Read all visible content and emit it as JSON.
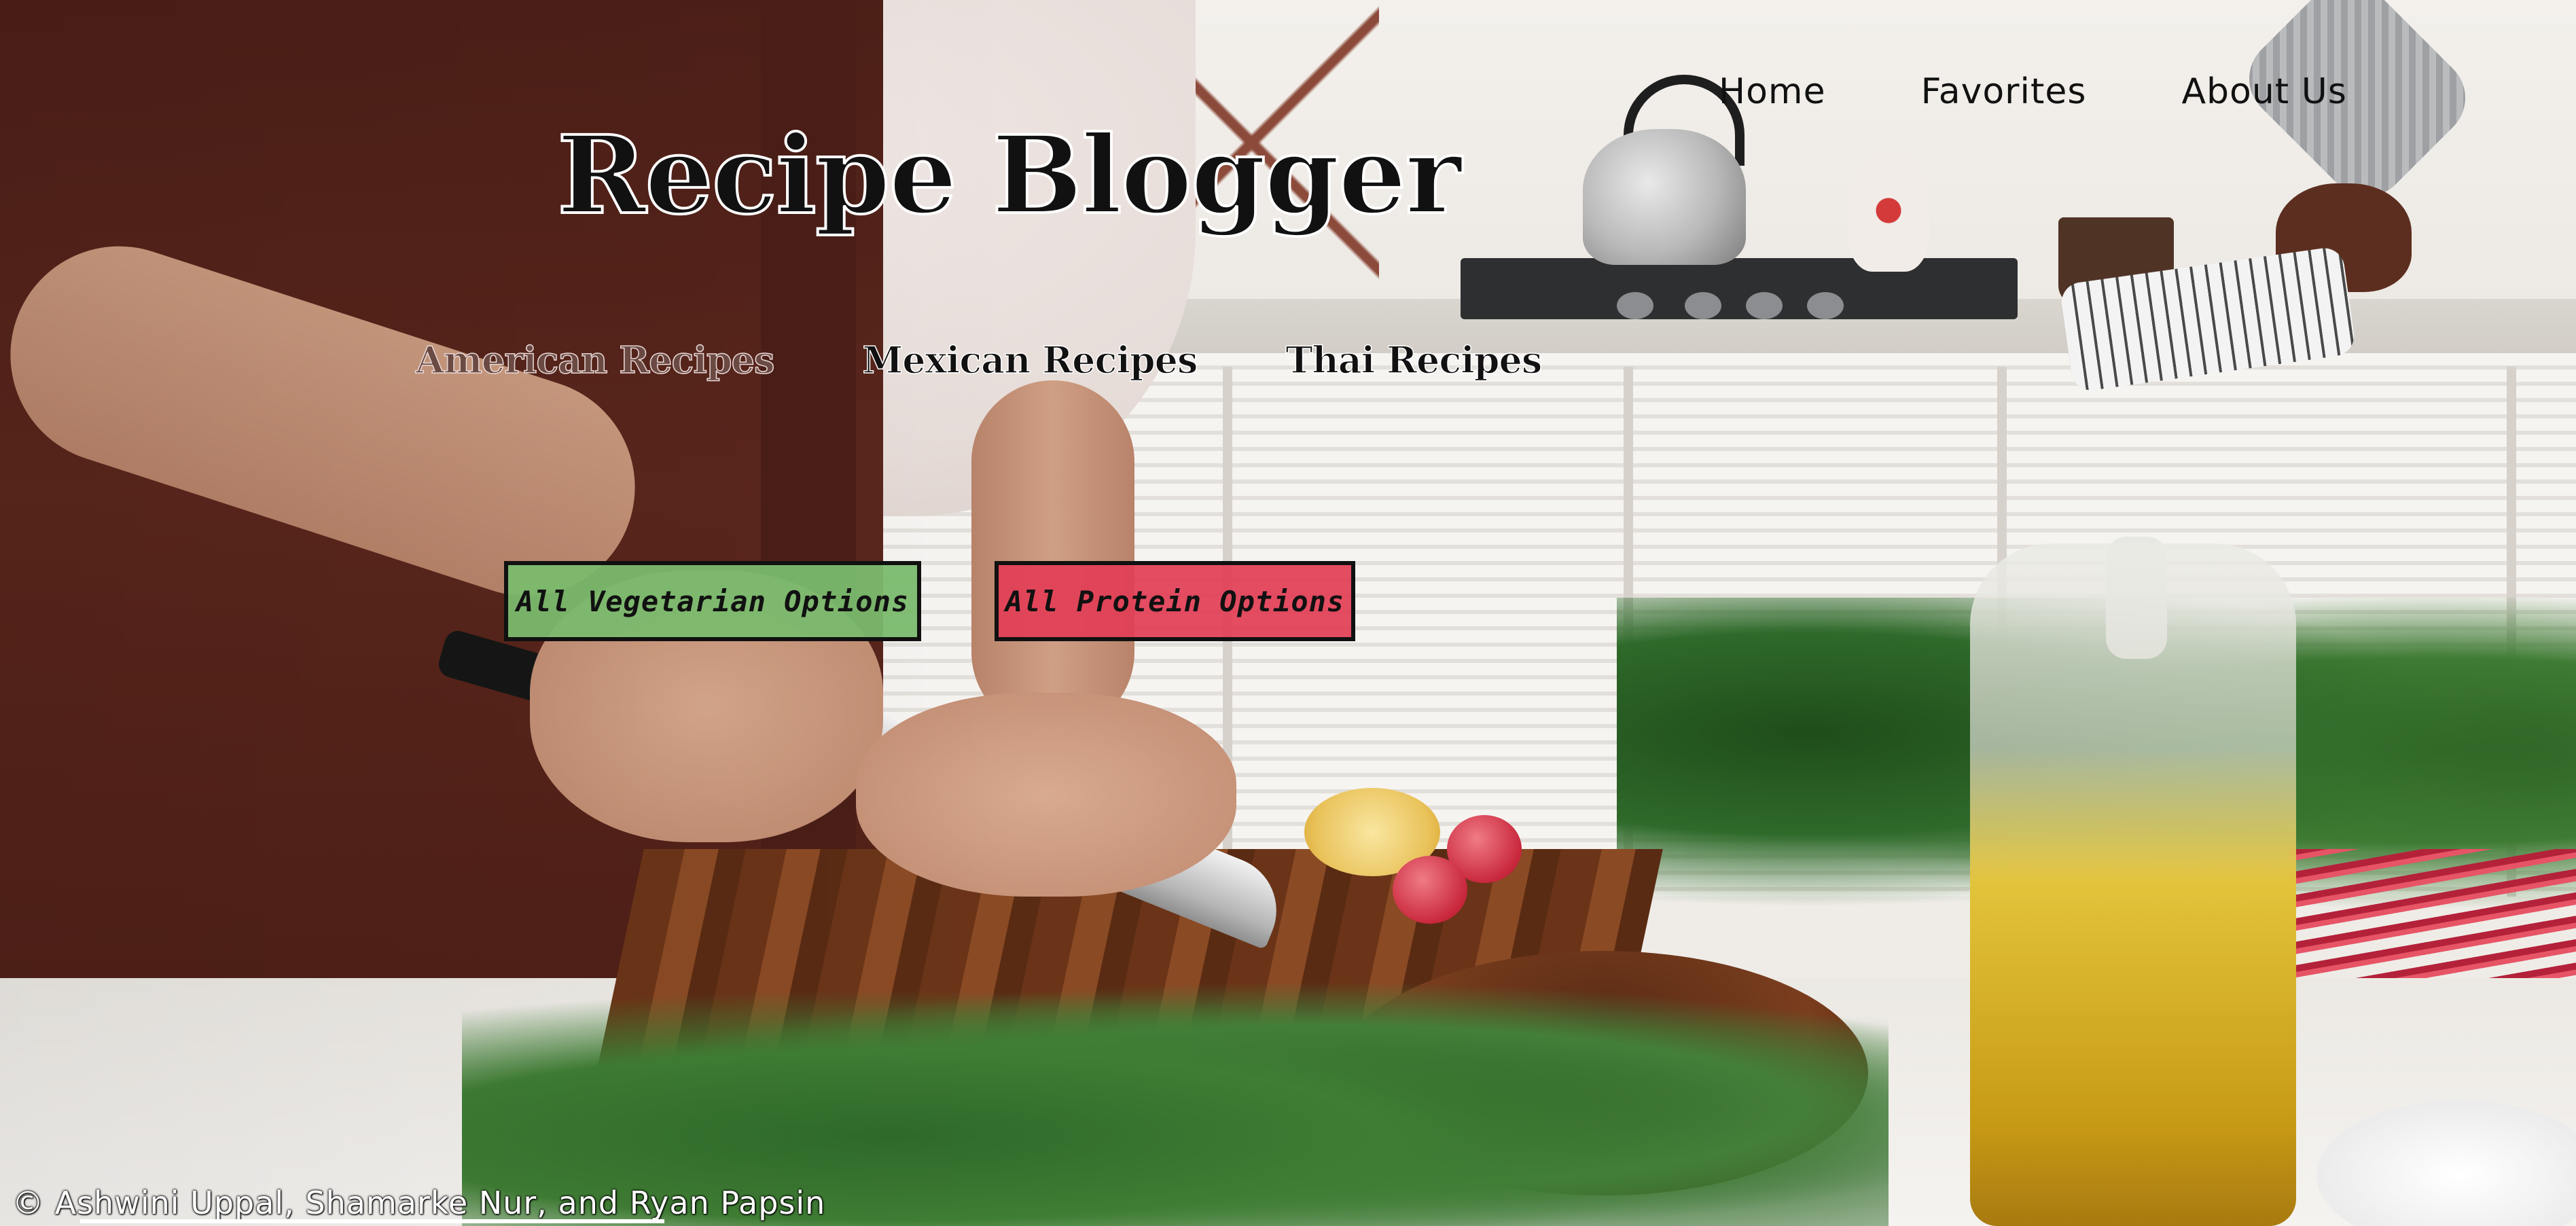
{
  "site": {
    "title": "Recipe Blogger"
  },
  "top_nav": {
    "items": [
      {
        "label": "Home"
      },
      {
        "label": "Favorites"
      },
      {
        "label": "About Us"
      }
    ]
  },
  "category_nav": {
    "items": [
      {
        "label": "American Recipes"
      },
      {
        "label": "Mexican Recipes"
      },
      {
        "label": "Thai Recipes"
      }
    ]
  },
  "options": {
    "vegetarian_label": "All Vegetarian Options",
    "protein_label": "All Protein Options"
  },
  "footer": {
    "credit": "© Ashwini Uppal, Shamarke Nur, and Ryan Papsin"
  },
  "colors": {
    "title_text": "#111111",
    "vegetarian_button": "#7aba6e",
    "protein_button": "#e23e56",
    "button_border": "#111111"
  }
}
